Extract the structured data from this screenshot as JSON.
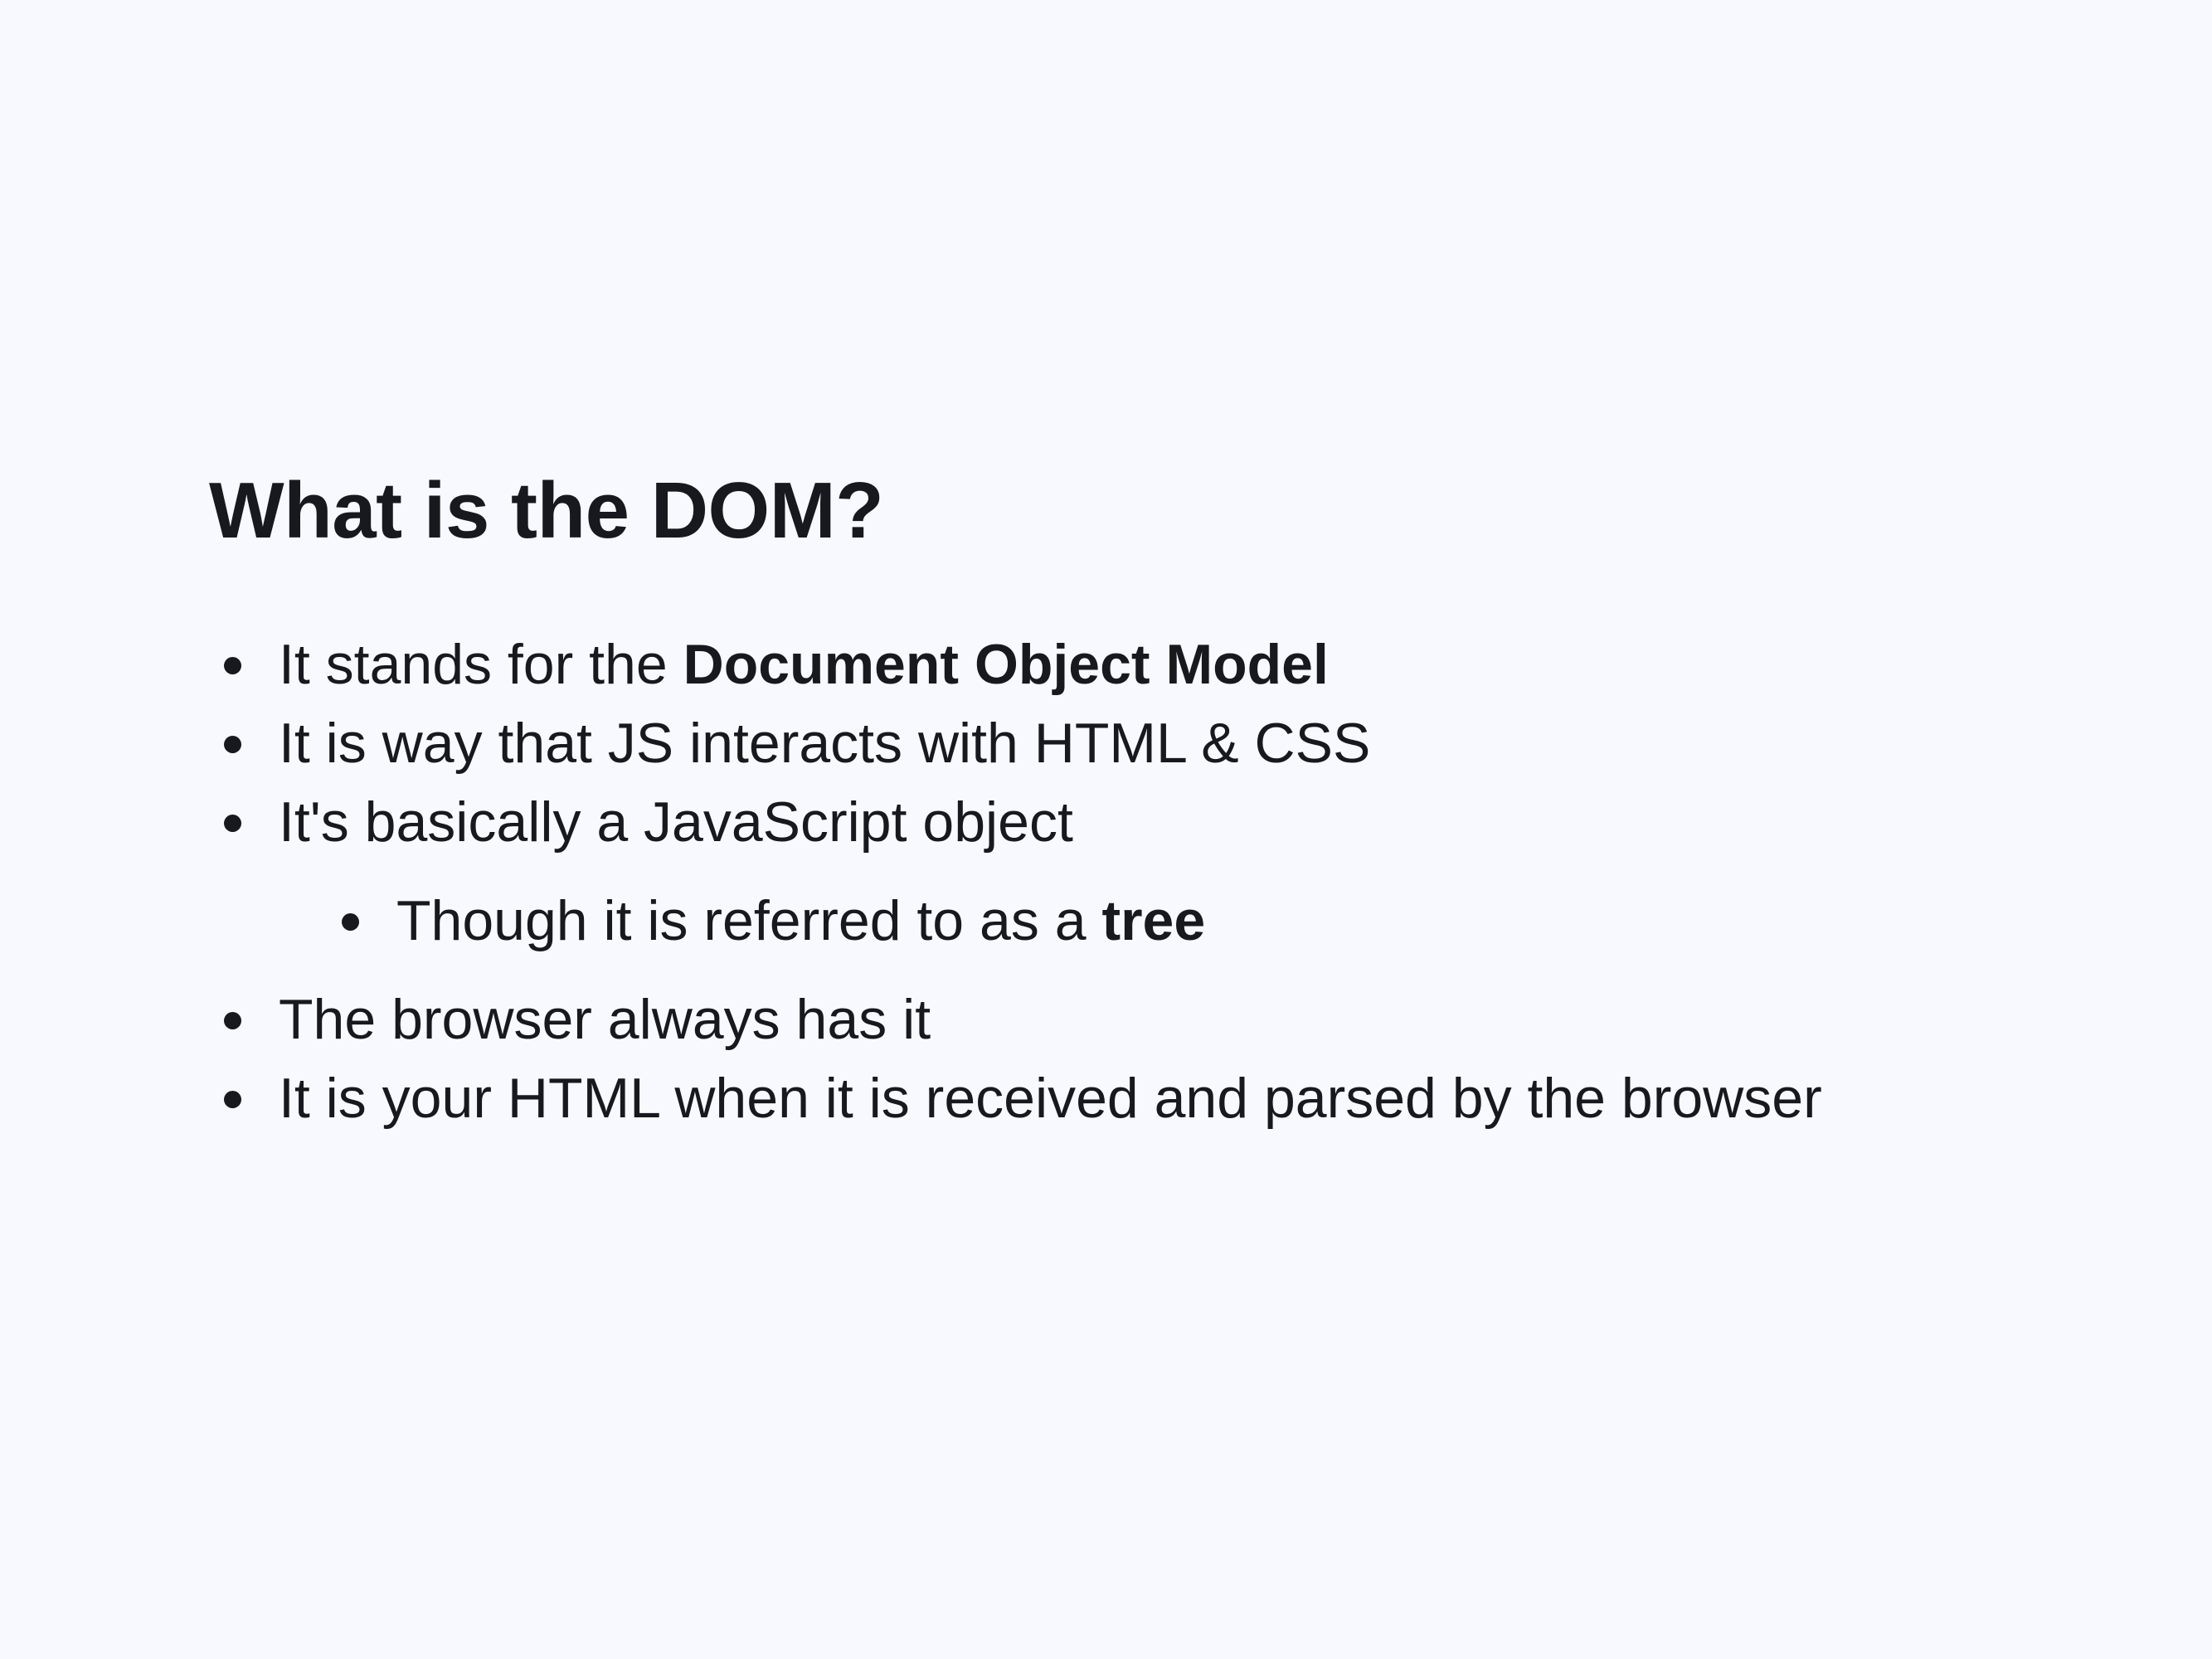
{
  "slide": {
    "title": "What is the DOM?",
    "bullets": [
      {
        "text": "It stands for the ",
        "bold": "Document Object Model"
      },
      {
        "text": "It is way that JS interacts with HTML & CSS"
      },
      {
        "text": "It's basically a JavaScript object"
      },
      {
        "text": "Though it is referred to as a ",
        "bold": "tree"
      },
      {
        "text": "The browser always has it"
      },
      {
        "text": "It is your HTML when it is received and parsed by the browser"
      }
    ]
  }
}
